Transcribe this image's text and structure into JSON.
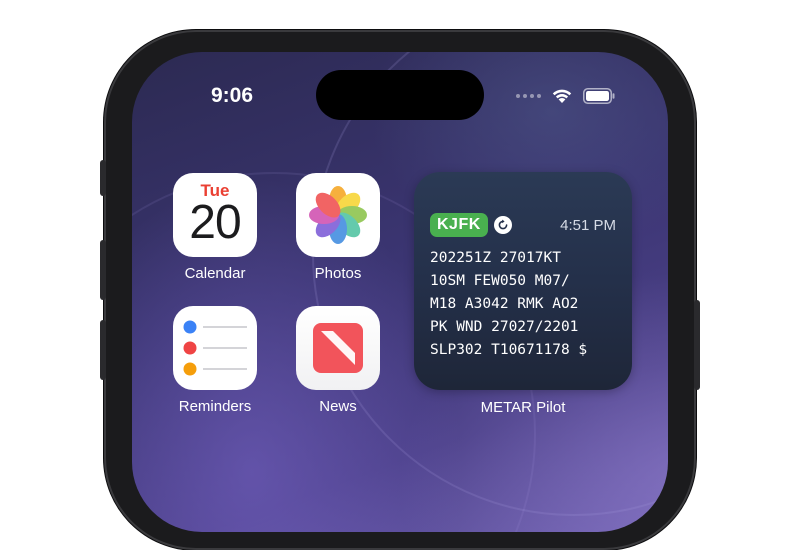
{
  "status_bar": {
    "time": "9:06"
  },
  "apps": [
    {
      "name": "Calendar",
      "icon": "calendar-icon",
      "day": "Tue",
      "date": "20"
    },
    {
      "name": "Photos",
      "icon": "photos-flower-icon"
    },
    {
      "name": "Reminders",
      "icon": "reminders-list-icon"
    },
    {
      "name": "News",
      "icon": "news-icon"
    }
  ],
  "widget": {
    "app_label": "METAR Pilot",
    "station": "KJFK",
    "time": "4:51 PM",
    "lines": [
      "202251Z 27017KT",
      "10SM FEW050 M07/",
      "M18 A3042 RMK AO2",
      "PK WND 27027/2201",
      "SLP302 T10671178 $"
    ],
    "colors": {
      "station_badge": "#49b04f",
      "background": "#24304a"
    }
  },
  "colors": {
    "calendar_day": "#ea4033",
    "news_red": "#f2545b"
  }
}
